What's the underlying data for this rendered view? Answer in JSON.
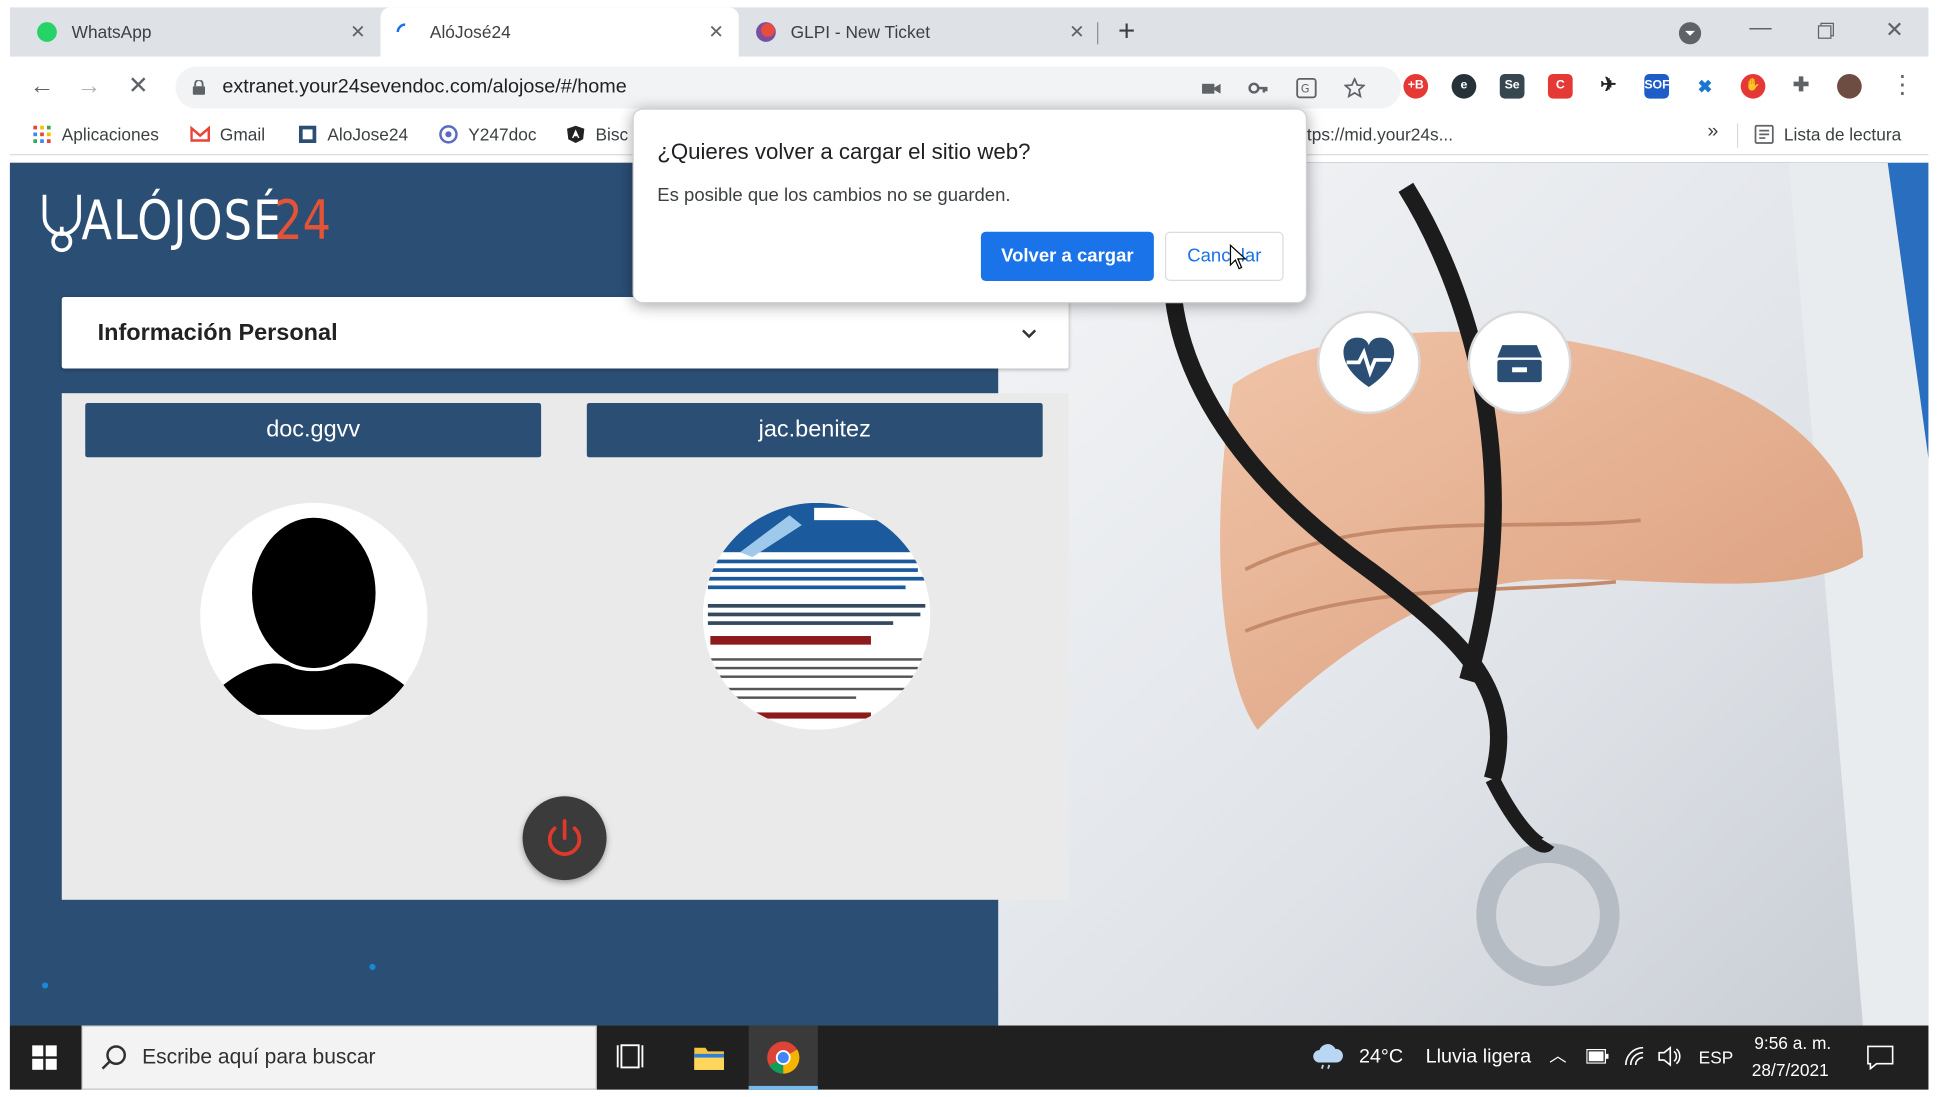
{
  "browser": {
    "tabs": [
      {
        "title": "WhatsApp",
        "favicon": "whatsapp-icon",
        "color": "#25d366"
      },
      {
        "title": "AlóJosé24",
        "favicon": "loading-spinner-icon",
        "color": "#1a73e8"
      },
      {
        "title": "GLPI - New Ticket",
        "favicon": "glpi-icon",
        "color": "#c0392b"
      }
    ],
    "url": "extranet.your24sevendoc.com/alojose/#/home",
    "bookmarks": [
      {
        "label": "Aplicaciones",
        "icon": "apps-grid-icon"
      },
      {
        "label": "Gmail",
        "icon": "gmail-icon"
      },
      {
        "label": "AloJose24",
        "icon": "alojose-icon"
      },
      {
        "label": "Y247doc",
        "icon": "y247doc-icon"
      },
      {
        "label": "Bisc",
        "icon": "angular-icon"
      },
      {
        "label": "ttps://mid.your24s...",
        "icon": ""
      }
    ],
    "bookmarks_overflow": "»",
    "reading_list": "Lista de lectura"
  },
  "dialog": {
    "title": "¿Quieres volver a cargar el sitio web?",
    "message": "Es posible que los cambios no se guarden.",
    "reload_label": "Volver a cargar",
    "cancel_label": "Cancelar"
  },
  "app": {
    "logo_text": "ALÓJOSÉ",
    "logo_number": "24",
    "section_title": "Información Personal",
    "users": [
      {
        "username": "doc.ggvv",
        "avatar": "default-person-silhouette"
      },
      {
        "username": "jac.benitez",
        "avatar": "covid-vaccine-infographic"
      }
    ],
    "action_icons": [
      "heart-pulse-icon",
      "archive-box-icon"
    ],
    "colors": {
      "primary": "#2b4e74",
      "power_red": "#e0392b",
      "logo_accent": "#e35336"
    }
  },
  "taskbar": {
    "search_placeholder": "Escribe aquí para buscar",
    "weather_temp": "24°C",
    "weather_desc": "Lluvia ligera",
    "lang": "ESP",
    "time": "9:56 a. m.",
    "date": "28/7/2021"
  }
}
